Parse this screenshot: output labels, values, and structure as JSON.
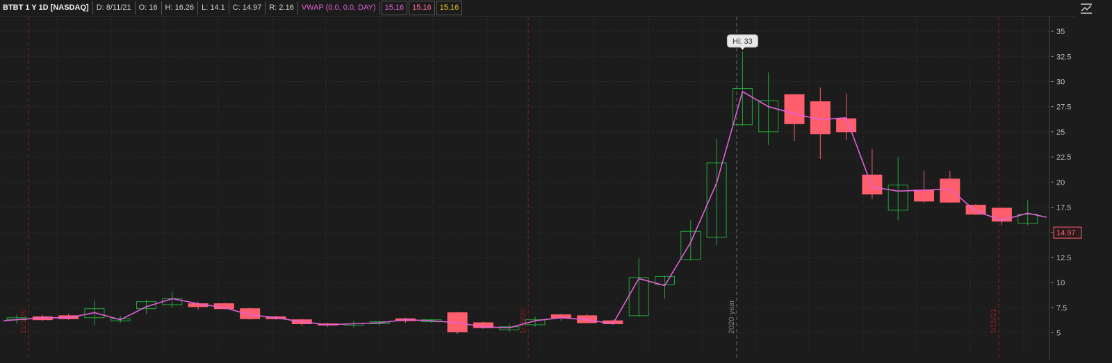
{
  "header": {
    "symbol": "BTBT 1 Y 1D [NASDAQ]",
    "date": "D: 8/11/21",
    "open": "O: 16",
    "high": "H: 16.26",
    "low": "L: 14.1",
    "close": "C: 14.97",
    "range": "R: 2.16",
    "vwap_label": "VWAP (0.0, 0.0, DAY)",
    "vwap_values": [
      "15.16",
      "15.16",
      "15.16"
    ]
  },
  "colors": {
    "background": "#1c1c1c",
    "up": "#22a83a",
    "down": "#ff5f6d",
    "vwap": "#e061d8",
    "separator": "#8a1f1f",
    "grid": "#3a3a3a"
  },
  "icons": {
    "corner": "expand-chart-icon"
  },
  "chart_data": {
    "type": "candlestick",
    "ylim": [
      3.5,
      36.5
    ],
    "yticks": [
      "35",
      "32.5",
      "30",
      "27.5",
      "25",
      "22.5",
      "20",
      "17.5",
      "15",
      "12.5",
      "10",
      "7.5",
      "5"
    ],
    "current_price": "14.97",
    "high_callout": "Hi: 33",
    "separators": [
      {
        "label": "11/1/20"
      },
      {
        "label": "1/18/20"
      },
      {
        "label": "2020 year"
      },
      {
        "label": "3/15/21"
      }
    ],
    "candles": [
      {
        "o": 6.3,
        "h": 6.8,
        "l": 5.9,
        "c": 6.5
      },
      {
        "o": 6.6,
        "h": 6.8,
        "l": 6.2,
        "c": 6.3
      },
      {
        "o": 6.7,
        "h": 6.9,
        "l": 6.3,
        "c": 6.4
      },
      {
        "o": 6.5,
        "h": 8.2,
        "l": 5.8,
        "c": 7.4
      },
      {
        "o": 6.2,
        "h": 6.7,
        "l": 6.0,
        "c": 6.4
      },
      {
        "o": 7.4,
        "h": 8.3,
        "l": 6.9,
        "c": 8.1
      },
      {
        "o": 7.8,
        "h": 9.1,
        "l": 7.5,
        "c": 8.4
      },
      {
        "o": 7.9,
        "h": 8.1,
        "l": 7.3,
        "c": 7.6
      },
      {
        "o": 7.9,
        "h": 8.0,
        "l": 7.3,
        "c": 7.4
      },
      {
        "o": 7.4,
        "h": 7.5,
        "l": 6.3,
        "c": 6.4
      },
      {
        "o": 6.6,
        "h": 6.7,
        "l": 6.3,
        "c": 6.4
      },
      {
        "o": 6.3,
        "h": 6.4,
        "l": 5.7,
        "c": 5.9
      },
      {
        "o": 5.9,
        "h": 6.0,
        "l": 5.6,
        "c": 5.8
      },
      {
        "o": 5.8,
        "h": 6.2,
        "l": 5.5,
        "c": 5.9
      },
      {
        "o": 5.9,
        "h": 6.2,
        "l": 5.7,
        "c": 6.1
      },
      {
        "o": 6.4,
        "h": 6.5,
        "l": 6.0,
        "c": 6.2
      },
      {
        "o": 6.1,
        "h": 6.4,
        "l": 6.0,
        "c": 6.3
      },
      {
        "o": 7.0,
        "h": 7.1,
        "l": 4.9,
        "c": 5.1
      },
      {
        "o": 6.0,
        "h": 6.1,
        "l": 5.4,
        "c": 5.5
      },
      {
        "o": 5.3,
        "h": 5.9,
        "l": 5.1,
        "c": 5.6
      },
      {
        "o": 5.8,
        "h": 6.6,
        "l": 5.6,
        "c": 6.3
      },
      {
        "o": 6.8,
        "h": 6.9,
        "l": 6.2,
        "c": 6.5
      },
      {
        "o": 6.7,
        "h": 6.9,
        "l": 6.0,
        "c": 6.0
      },
      {
        "o": 6.2,
        "h": 6.3,
        "l": 5.8,
        "c": 5.9
      },
      {
        "o": 6.7,
        "h": 12.4,
        "l": 6.6,
        "c": 10.5
      },
      {
        "o": 9.8,
        "h": 10.7,
        "l": 8.4,
        "c": 10.6
      },
      {
        "o": 12.3,
        "h": 16.2,
        "l": 12.2,
        "c": 15.1
      },
      {
        "o": 14.5,
        "h": 24.3,
        "l": 13.7,
        "c": 21.9
      },
      {
        "o": 25.7,
        "h": 33.0,
        "l": 25.6,
        "c": 29.3
      },
      {
        "o": 25.0,
        "h": 30.9,
        "l": 23.7,
        "c": 28.1
      },
      {
        "o": 28.7,
        "h": 28.8,
        "l": 24.1,
        "c": 25.8
      },
      {
        "o": 28.0,
        "h": 29.4,
        "l": 22.3,
        "c": 24.8
      },
      {
        "o": 26.3,
        "h": 28.8,
        "l": 24.2,
        "c": 25.0
      },
      {
        "o": 20.7,
        "h": 23.3,
        "l": 18.3,
        "c": 18.8
      },
      {
        "o": 17.2,
        "h": 22.5,
        "l": 16.2,
        "c": 19.7
      },
      {
        "o": 19.2,
        "h": 21.1,
        "l": 17.9,
        "c": 18.1
      },
      {
        "o": 20.3,
        "h": 21.1,
        "l": 17.9,
        "c": 18.0
      },
      {
        "o": 17.7,
        "h": 17.8,
        "l": 16.7,
        "c": 16.8
      },
      {
        "o": 17.4,
        "h": 17.5,
        "l": 15.7,
        "c": 16.1
      },
      {
        "o": 15.9,
        "h": 18.2,
        "l": 15.7,
        "c": 16.8
      }
    ],
    "vwap": [
      6.2,
      6.5,
      6.5,
      7.0,
      6.3,
      7.6,
      8.4,
      7.9,
      7.5,
      6.8,
      6.5,
      6.1,
      5.8,
      5.9,
      6.0,
      6.3,
      6.2,
      6.0,
      5.6,
      5.5,
      6.2,
      6.5,
      6.3,
      5.9,
      10.4,
      9.7,
      14.0,
      19.9,
      29.0,
      27.5,
      26.8,
      26.2,
      26.4,
      19.5,
      19.1,
      19.2,
      19.3,
      17.1,
      16.2,
      16.9,
      16.5
    ]
  }
}
